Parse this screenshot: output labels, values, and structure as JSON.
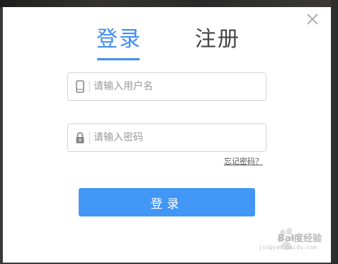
{
  "tabs": {
    "login_label": "登录",
    "register_label": "注册",
    "active": "login"
  },
  "username": {
    "placeholder": "请输入用户名",
    "value": "",
    "icon": "phone-icon"
  },
  "password": {
    "placeholder": "请输入密码",
    "value": "",
    "icon": "lock-icon"
  },
  "forgot_password_label": "忘记密码？",
  "login_button_label": "登录",
  "close_icon": "close-icon",
  "watermark": {
    "text": "Bai度经验",
    "url_text": "jingyan.baidu.com"
  },
  "colors": {
    "accent": "#3f8ef3",
    "button": "#4296f5",
    "tab_inactive": "#444444"
  }
}
